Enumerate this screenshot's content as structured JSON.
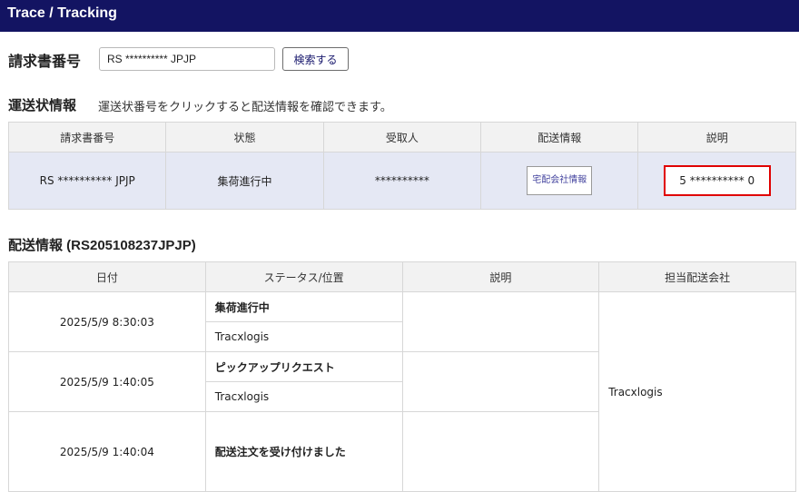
{
  "header": {
    "title": "Trace / Tracking"
  },
  "search": {
    "label": "請求書番号",
    "value": "RS ********** JPJP",
    "button": "検索する"
  },
  "waybill_section": {
    "title": "運送状情報",
    "note": "運送状番号をクリックすると配送情報を確認できます。",
    "columns": [
      "請求書番号",
      "状態",
      "受取人",
      "配送情報",
      "説明"
    ],
    "row": {
      "invoice": "RS ********** JPJP",
      "status": "集荷進行中",
      "recipient": "**********",
      "courier_button": "宅配会社情報",
      "description": "5 ********** 0"
    }
  },
  "detail_section": {
    "title": "配送情報 (RS205108237JPJP)",
    "columns": [
      "日付",
      "ステータス/位置",
      "説明",
      "担当配送会社"
    ],
    "rows": [
      {
        "date": "2025/5/9 8:30:03",
        "status": "集荷進行中",
        "location": "Tracxlogis"
      },
      {
        "date": "2025/5/9 1:40:05",
        "status": "ピックアップリクエスト",
        "location": "Tracxlogis"
      },
      {
        "date": "2025/5/9 1:40:04",
        "status": "配送注文を受け付けました"
      }
    ],
    "carrier": "Tracxlogis"
  },
  "colors": {
    "header_bg": "#131462",
    "highlight_border": "#e00000",
    "row_bg": "#e5e8f4"
  }
}
